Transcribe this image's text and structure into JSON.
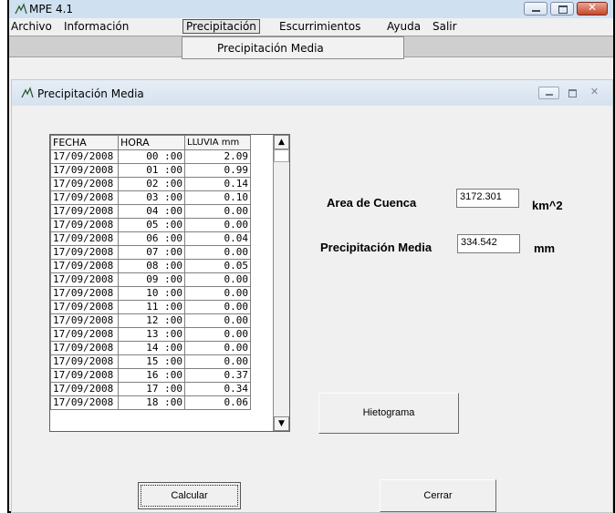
{
  "window": {
    "title": "MPE 4.1"
  },
  "menu": {
    "items": [
      "Archivo",
      "Información",
      "Precipitación",
      "Escurrimientos",
      "Ayuda",
      "Salir"
    ],
    "active": "Precipitación"
  },
  "dropdown": {
    "item": "Precipitación Media"
  },
  "child_window": {
    "title": "Precipitación Media"
  },
  "grid": {
    "columns": [
      "FECHA",
      "HORA",
      "LLUVIA mm"
    ],
    "rows": [
      [
        "17/09/2008",
        "00 :00",
        "2.09"
      ],
      [
        "17/09/2008",
        "01 :00",
        "0.99"
      ],
      [
        "17/09/2008",
        "02 :00",
        "0.14"
      ],
      [
        "17/09/2008",
        "03 :00",
        "0.10"
      ],
      [
        "17/09/2008",
        "04 :00",
        "0.00"
      ],
      [
        "17/09/2008",
        "05 :00",
        "0.00"
      ],
      [
        "17/09/2008",
        "06 :00",
        "0.04"
      ],
      [
        "17/09/2008",
        "07 :00",
        "0.00"
      ],
      [
        "17/09/2008",
        "08 :00",
        "0.05"
      ],
      [
        "17/09/2008",
        "09 :00",
        "0.00"
      ],
      [
        "17/09/2008",
        "10 :00",
        "0.00"
      ],
      [
        "17/09/2008",
        "11 :00",
        "0.00"
      ],
      [
        "17/09/2008",
        "12 :00",
        "0.00"
      ],
      [
        "17/09/2008",
        "13 :00",
        "0.00"
      ],
      [
        "17/09/2008",
        "14 :00",
        "0.00"
      ],
      [
        "17/09/2008",
        "15 :00",
        "0.00"
      ],
      [
        "17/09/2008",
        "16 :00",
        "0.37"
      ],
      [
        "17/09/2008",
        "17 :00",
        "0.34"
      ],
      [
        "17/09/2008",
        "18 :00",
        "0.06"
      ]
    ]
  },
  "fields": {
    "area": {
      "label": "Area de Cuenca",
      "value": "3172.301",
      "unit": "km^2"
    },
    "precip": {
      "label": "Precipitación Media",
      "value": "334.542",
      "unit": "mm"
    }
  },
  "buttons": {
    "hietograma": "Hietograma",
    "calcular": "Calcular",
    "cerrar": "Cerrar"
  },
  "icons": {
    "scroll_up": "up-arrow-icon",
    "scroll_down": "down-arrow-icon",
    "app": "app-icon"
  }
}
